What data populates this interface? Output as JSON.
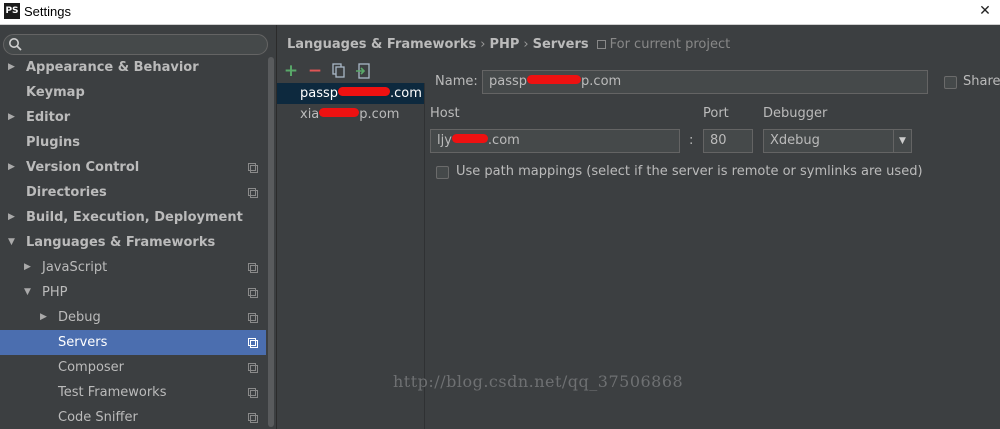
{
  "window": {
    "app_badge": "PS",
    "title": "Settings",
    "close_glyph": "✕"
  },
  "search": {
    "placeholder": ""
  },
  "tree": [
    {
      "label": "Appearance & Behavior",
      "level": 0,
      "bold": true,
      "arrow": "right",
      "project_icon": false,
      "selected": false
    },
    {
      "label": "Keymap",
      "level": 0,
      "bold": true,
      "arrow": "none",
      "project_icon": false,
      "selected": false
    },
    {
      "label": "Editor",
      "level": 0,
      "bold": true,
      "arrow": "right",
      "project_icon": false,
      "selected": false
    },
    {
      "label": "Plugins",
      "level": 0,
      "bold": true,
      "arrow": "none",
      "project_icon": false,
      "selected": false
    },
    {
      "label": "Version Control",
      "level": 0,
      "bold": true,
      "arrow": "right",
      "project_icon": true,
      "selected": false
    },
    {
      "label": "Directories",
      "level": 0,
      "bold": true,
      "arrow": "none",
      "project_icon": true,
      "selected": false
    },
    {
      "label": "Build, Execution, Deployment",
      "level": 0,
      "bold": true,
      "arrow": "right",
      "project_icon": false,
      "selected": false
    },
    {
      "label": "Languages & Frameworks",
      "level": 0,
      "bold": true,
      "arrow": "down",
      "project_icon": false,
      "selected": false
    },
    {
      "label": "JavaScript",
      "level": 1,
      "bold": false,
      "arrow": "right",
      "project_icon": true,
      "selected": false
    },
    {
      "label": "PHP",
      "level": 1,
      "bold": false,
      "arrow": "down",
      "project_icon": true,
      "selected": false
    },
    {
      "label": "Debug",
      "level": 2,
      "bold": false,
      "arrow": "right",
      "project_icon": true,
      "selected": false
    },
    {
      "label": "Servers",
      "level": 2,
      "bold": false,
      "arrow": "none",
      "project_icon": true,
      "selected": true
    },
    {
      "label": "Composer",
      "level": 2,
      "bold": false,
      "arrow": "none",
      "project_icon": true,
      "selected": false
    },
    {
      "label": "Test Frameworks",
      "level": 2,
      "bold": false,
      "arrow": "none",
      "project_icon": true,
      "selected": false
    },
    {
      "label": "Code Sniffer",
      "level": 2,
      "bold": false,
      "arrow": "none",
      "project_icon": true,
      "selected": false
    }
  ],
  "breadcrumb": {
    "part1": "Languages & Frameworks",
    "part2": "PHP",
    "part3": "Servers",
    "separator": "›",
    "scope": "For current project"
  },
  "toolbar": {
    "add": "+",
    "remove": "−",
    "add_color": "#59a869",
    "remove_color": "#e05555"
  },
  "servers": [
    {
      "prefix": "passp",
      "suffix": ".com",
      "selected": true
    },
    {
      "prefix": "xia",
      "suffix": "p.com",
      "selected": false
    }
  ],
  "form": {
    "name_label": "Name:",
    "name_prefix": "passp",
    "name_suffix": "p.com",
    "shared_label": "Shared",
    "host_label": "Host",
    "host_prefix": "ljy",
    "host_suffix": ".com",
    "colon": ":",
    "port_label": "Port",
    "port_value": "80",
    "debugger_label": "Debugger",
    "debugger_value": "Xdebug",
    "path_mappings_label": "Use path mappings (select if the server is remote or symlinks are used)",
    "shared_checked": false,
    "path_mappings_checked": false
  },
  "watermark": "http://blog.csdn.net/qq_37506868",
  "colors": {
    "background": "#3c3f41",
    "selection": "#4b6eaf",
    "list_selection": "#0d293e",
    "redaction": "#ee1111"
  }
}
